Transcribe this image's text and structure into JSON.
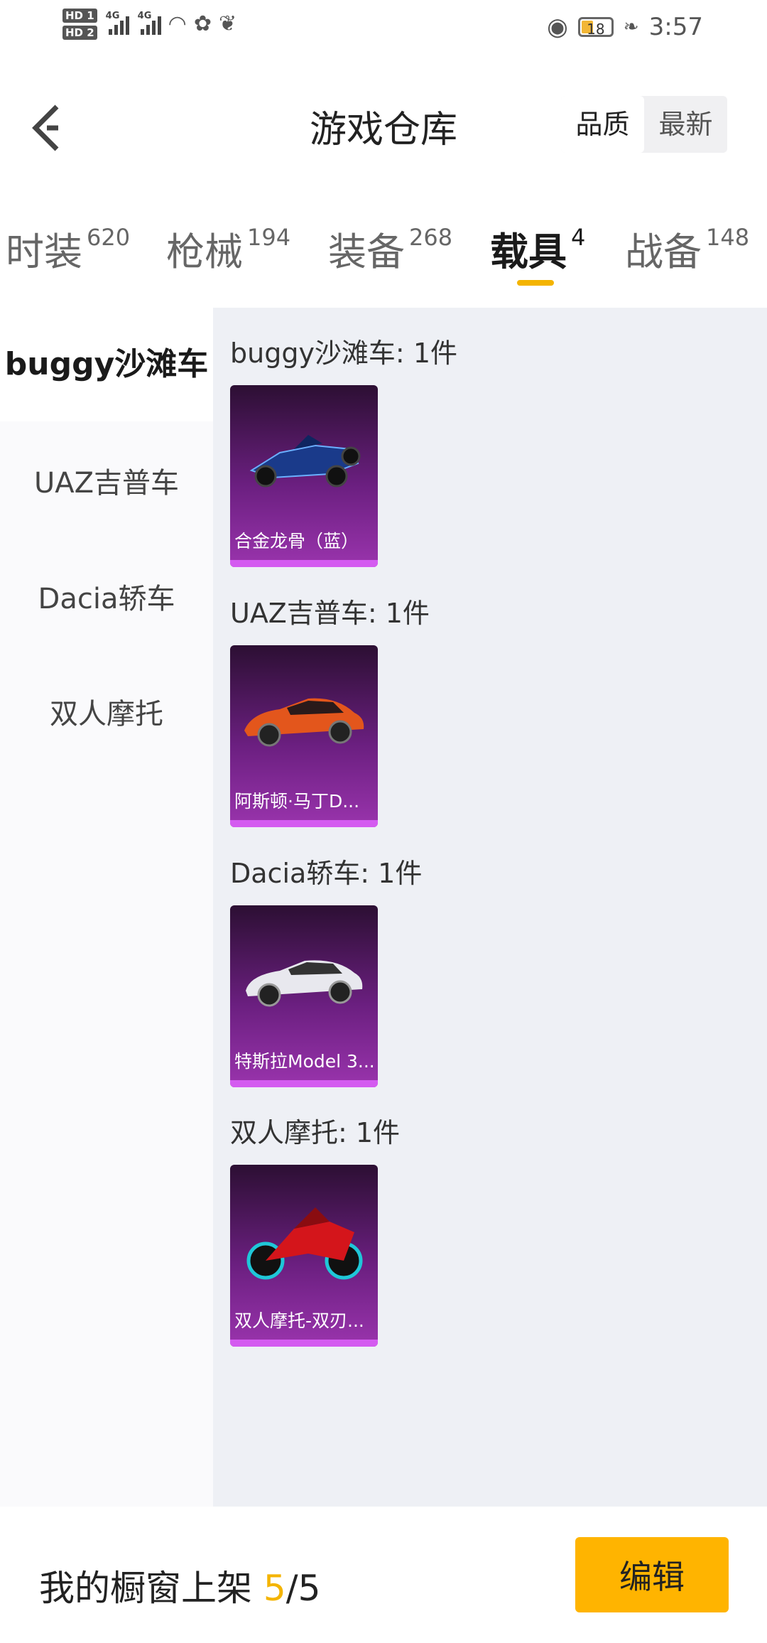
{
  "status_bar": {
    "hd1": "HD 1",
    "hd2": "HD 2",
    "net1": "4G",
    "net2": "4G",
    "battery": "18",
    "time": "3:57"
  },
  "header": {
    "title": "游戏仓库",
    "sort_quality": "品质",
    "sort_newest": "最新"
  },
  "tabs": [
    {
      "label": "时装",
      "count": "620"
    },
    {
      "label": "枪械",
      "count": "194"
    },
    {
      "label": "装备",
      "count": "268"
    },
    {
      "label": "载具",
      "count": "4",
      "active": true
    },
    {
      "label": "战备",
      "count": "148"
    }
  ],
  "sidebar": [
    {
      "label": "buggy沙滩车",
      "active": true
    },
    {
      "label": "UAZ吉普车"
    },
    {
      "label": "Dacia轿车"
    },
    {
      "label": "双人摩托"
    }
  ],
  "sections": [
    {
      "label": "buggy沙滩车: 1件",
      "item": "合金龙骨（蓝）"
    },
    {
      "label": "UAZ吉普车: 1件",
      "item": "阿斯顿·马丁D..."
    },
    {
      "label": "Dacia轿车: 1件",
      "item": "特斯拉Model 3..."
    },
    {
      "label": "双人摩托: 1件",
      "item": "双人摩托-双刃..."
    }
  ],
  "bottom": {
    "shelf_label": "我的橱窗上架 ",
    "shelf_current": "5",
    "shelf_total": "/5",
    "edit_label": "编辑"
  },
  "colors": {
    "accent": "#f4b400",
    "card_purple": "#6b1f80",
    "card_stripe": "#d45bf0"
  }
}
